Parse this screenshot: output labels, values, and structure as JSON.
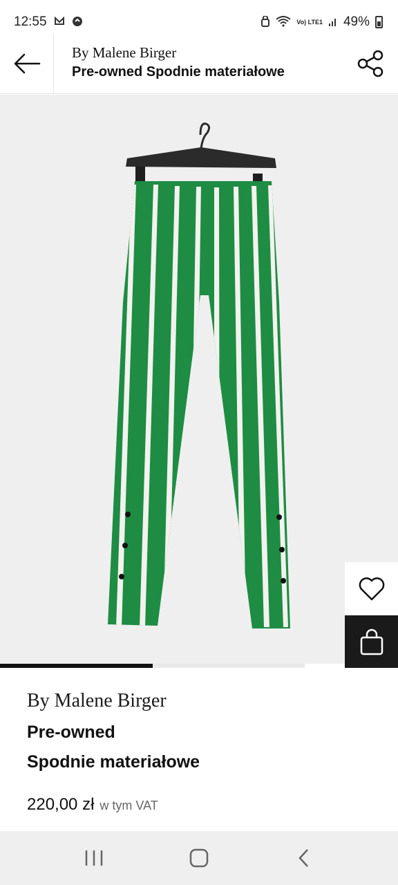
{
  "status_bar": {
    "time": "12:55",
    "battery": "49%",
    "left_icons": [
      "notification-icon",
      "vpn-icon"
    ],
    "right_icons": [
      "alarm-icon",
      "wifi-icon",
      "volte-icon",
      "signal-icon",
      "battery-icon"
    ],
    "network_label": "Vo) LTE1"
  },
  "header": {
    "brand": "By Malene Birger",
    "product": "Pre-owned Spodnie materiałowe",
    "back_icon": "arrow-left-icon",
    "share_icon": "share-icon"
  },
  "gallery": {
    "progress": 0.5,
    "track_fraction": 0.766,
    "image_alt": "green and white striped wide-leg trousers on a hanger"
  },
  "actions": {
    "wishlist_icon": "heart-icon",
    "bag_icon": "shopping-bag-icon"
  },
  "product": {
    "brand": "By Malene Birger",
    "name_line1": "Pre-owned",
    "name_line2": "Spodnie materiałowe",
    "price": "220,00 zł",
    "vat_note": "w tym VAT"
  },
  "nav": {
    "recents_icon": "recents-icon",
    "home_icon": "home-icon",
    "back_icon": "back-chevron-icon"
  },
  "colors": {
    "stripe_green": "#1e8c43",
    "stripe_white": "#f2f2ee",
    "hanger": "#2b2b2b",
    "image_bg": "#efefef",
    "bag_button": "#1a1a1a"
  }
}
